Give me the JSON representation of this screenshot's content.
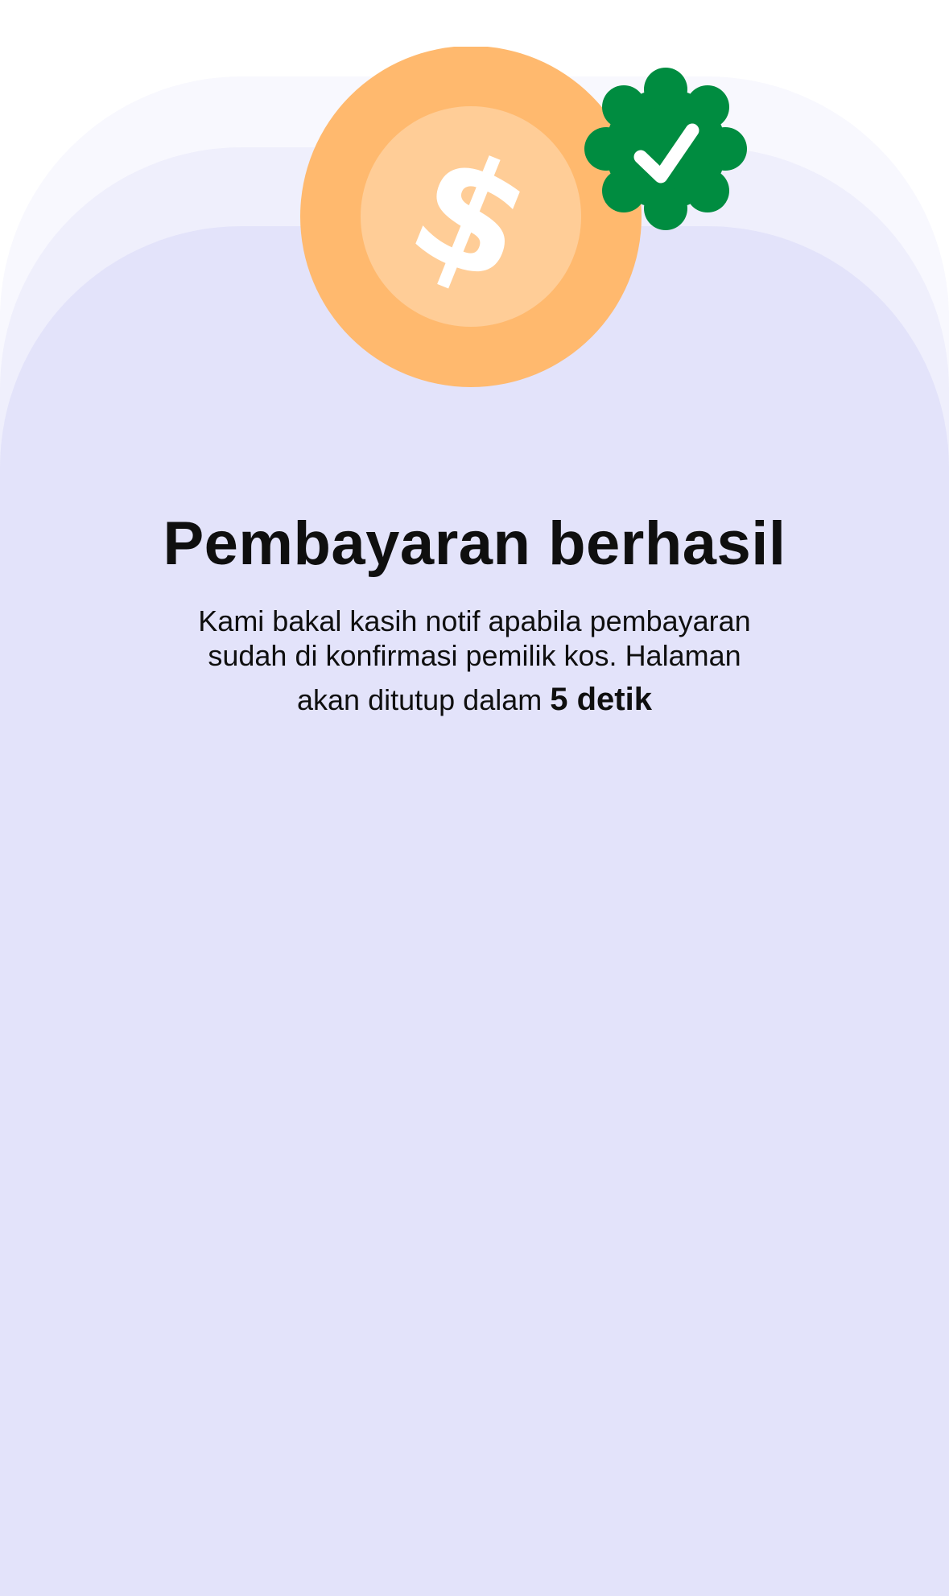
{
  "success": {
    "title": "Pembayaran berhasil",
    "message_line_1": "Kami bakal kasih notif apabila pembayaran",
    "message_line_2": "sudah di konfirmasi pemilik kos. Halaman",
    "message_line_3": "akan ditutup dalam",
    "countdown": "5 detik"
  },
  "illustration": {
    "coin_icon": "dollar-coin-icon",
    "badge_icon": "verified-check-badge-icon"
  },
  "colors": {
    "coin_outer": "#ffb96e",
    "coin_inner": "#ffcd97",
    "badge": "#008c40",
    "background_sheet": "#e3e3fa",
    "text": "#0f0f0f"
  }
}
